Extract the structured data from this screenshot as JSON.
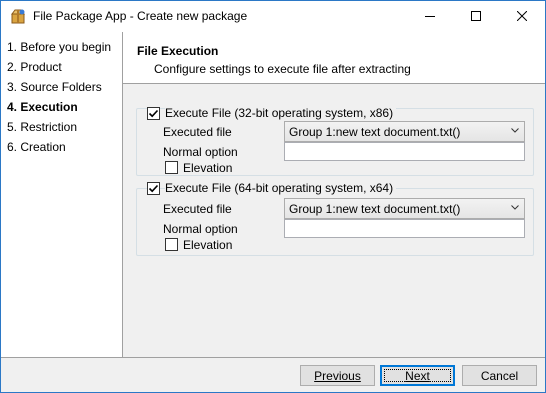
{
  "window": {
    "title": "File Package App - Create new package",
    "controls": {
      "minimize": "minimize",
      "maximize": "maximize",
      "close": "close"
    }
  },
  "sidebar": {
    "steps": [
      {
        "label": "1. Before you begin",
        "active": false
      },
      {
        "label": "2. Product",
        "active": false
      },
      {
        "label": "3. Source Folders",
        "active": false
      },
      {
        "label": "4. Execution",
        "active": true
      },
      {
        "label": "5. Restriction",
        "active": false
      },
      {
        "label": "6. Creation",
        "active": false
      }
    ]
  },
  "header": {
    "title": "File Execution",
    "subtitle": "Configure settings to execute file after extracting"
  },
  "groups": [
    {
      "checkbox_label": "Execute File (32-bit operating system, x86)",
      "checked": true,
      "executed_file_label": "Executed file",
      "executed_file_value": "Group 1:new text document.txt()",
      "normal_option_label": "Normal option",
      "normal_option_value": "",
      "elevation_label": "Elevation",
      "elevation_checked": false
    },
    {
      "checkbox_label": "Execute File (64-bit operating system, x64)",
      "checked": true,
      "executed_file_label": "Executed file",
      "executed_file_value": "Group 1:new text document.txt()",
      "normal_option_label": "Normal option",
      "normal_option_value": "",
      "elevation_label": "Elevation",
      "elevation_checked": false
    }
  ],
  "footer": {
    "previous": "Previous",
    "next": "Next",
    "cancel": "Cancel"
  },
  "colors": {
    "window_border": "#2b78c6",
    "panel_bg": "#f0f0f0",
    "focus_blue": "#0078d7"
  }
}
